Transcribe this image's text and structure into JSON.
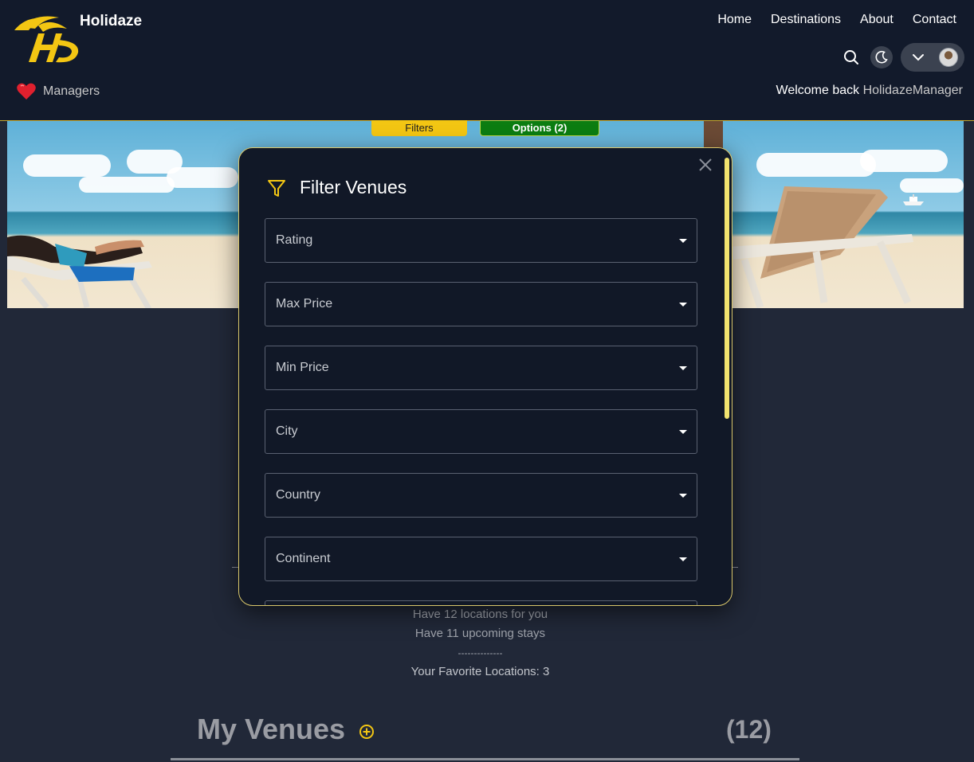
{
  "header": {
    "brand": "Holidaze",
    "nav": [
      "Home",
      "Destinations",
      "About",
      "Contact"
    ],
    "managers_label": "Managers",
    "welcome_prefix": "Welcome back",
    "username": "HolidazeManager"
  },
  "tabs": {
    "filters": "Filters",
    "options": "Options (2)"
  },
  "modal": {
    "title": "Filter Venues",
    "fields": [
      "Rating",
      "Max Price",
      "Min Price",
      "City",
      "Country",
      "Continent"
    ]
  },
  "stats": {
    "locations": "Have 12 locations for you",
    "stays": "Have 11 upcoming stays",
    "separator": "--------------",
    "favorites": "Your Favorite Locations: 3"
  },
  "venues": {
    "title": "My Venues",
    "count": "(12)"
  },
  "colors": {
    "accent_yellow": "#f3c613",
    "options_green": "#0b7d11",
    "header_bg": "#121a2b",
    "page_bg": "#212838",
    "modal_border": "#d8c66a"
  },
  "icons": [
    "logo-icon",
    "search-icon",
    "moon-icon",
    "chevron-down-icon",
    "heart-icon",
    "filter-icon",
    "close-icon",
    "add-circle-icon"
  ]
}
